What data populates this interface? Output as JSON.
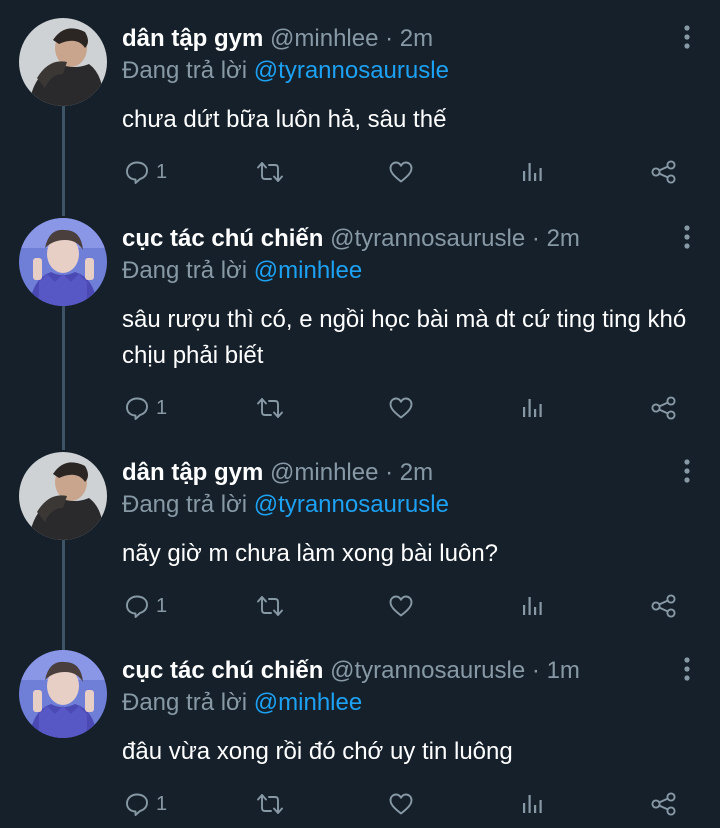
{
  "tweets": [
    {
      "name": "dân tập gym",
      "handle": "@minhlee",
      "separator": "·",
      "time": "2m",
      "reply_prefix": "Đang trả lời",
      "reply_to": "@tyrannosaurusle",
      "text": "chưa dứt bữa luôn hả, sâu thế",
      "reply_count": "1"
    },
    {
      "name": "cục tác chú chiến",
      "handle": "@tyrannosaurusle",
      "separator": "·",
      "time": "2m",
      "reply_prefix": "Đang trả lời",
      "reply_to": "@minhlee",
      "text": "sâu rượu thì có, e ngồi học bài mà dt cứ ting ting khó chịu phải biết",
      "reply_count": "1"
    },
    {
      "name": "dân tập gym",
      "handle": "@minhlee",
      "separator": "·",
      "time": "2m",
      "reply_prefix": "Đang trả lời",
      "reply_to": "@tyrannosaurusle",
      "text": "nãy giờ m chưa làm xong bài luôn?",
      "reply_count": "1"
    },
    {
      "name": "cục tác chú chiến",
      "handle": "@tyrannosaurusle",
      "separator": "·",
      "time": "1m",
      "reply_prefix": "Đang trả lời",
      "reply_to": "@minhlee",
      "text": "đâu vừa xong rồi đó chớ uy tin luông",
      "reply_count": "1"
    }
  ],
  "icons": {
    "reply": "reply-icon",
    "retweet": "retweet-icon",
    "like": "heart-icon",
    "analytics": "analytics-icon",
    "share": "share-icon",
    "more": "more-vertical-icon"
  },
  "colors": {
    "background": "#15202b",
    "primary_text": "#ffffff",
    "secondary_text": "#8899a6",
    "accent": "#1da1f2",
    "thread_line": "#3d5466"
  }
}
